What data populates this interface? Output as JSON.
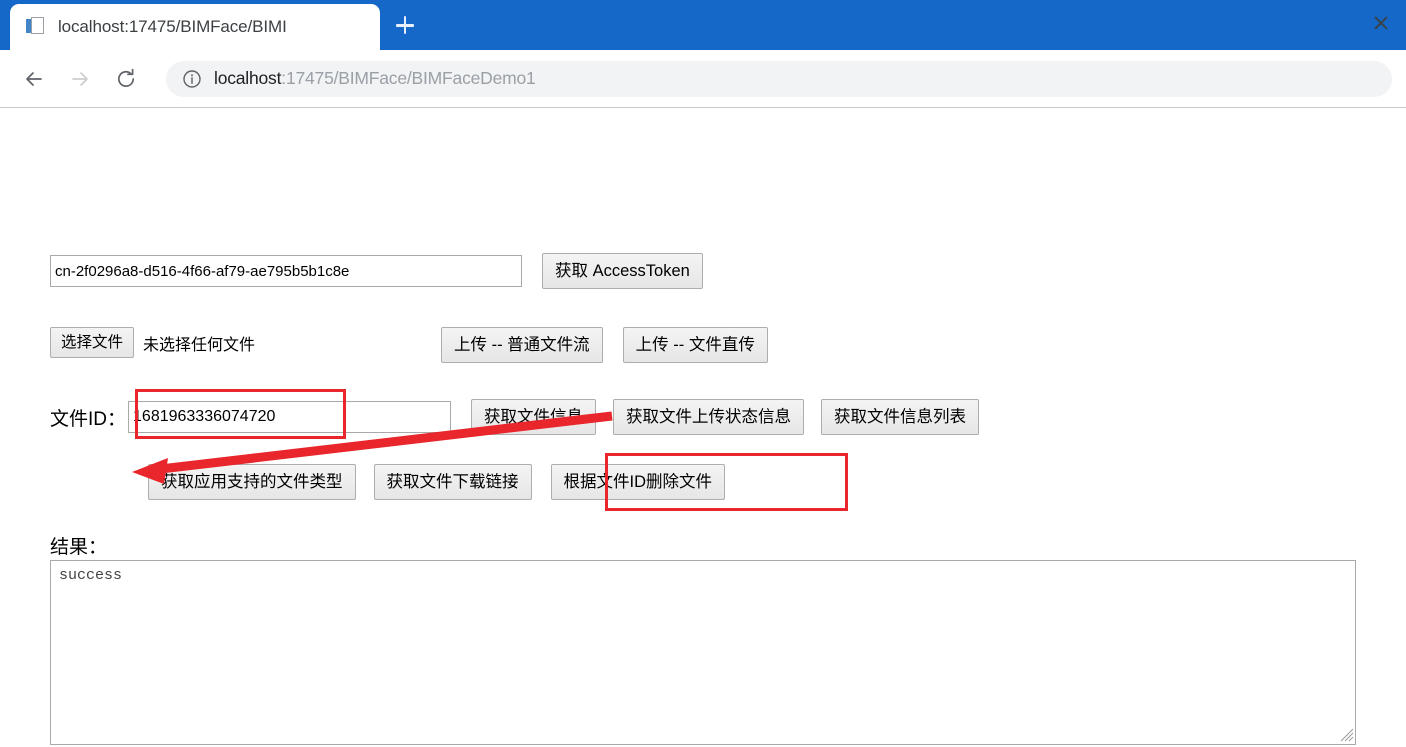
{
  "browser": {
    "tab": {
      "title": "localhost:17475/BIMFace/BIMI",
      "favicon": "page-document-icon",
      "close_label": "✕"
    },
    "new_tab_label": "+",
    "nav": {
      "back": "back-arrow-icon",
      "forward": "forward-arrow-icon",
      "reload": "reload-icon"
    },
    "omnibox": {
      "info_icon": "info-circle-icon",
      "host": "localhost",
      "path": ":17475/BIMFace/BIMFaceDemo1",
      "full_url": "localhost:17475/BIMFace/BIMFaceDemo1"
    },
    "accent_color": "#1568c8"
  },
  "page": {
    "token_row": {
      "input_value": "cn-2f0296a8-d516-4f66-af79-ae795b5b1c8e",
      "input_placeholder": "",
      "button_label": "获取 AccessToken"
    },
    "file_row": {
      "choose_label": "选择文件",
      "file_status": "未选择任何文件",
      "upload_stream_label": "上传 -- 普通文件流",
      "upload_direct_label": "上传 -- 文件直传"
    },
    "fileid_row": {
      "label": "文件ID：",
      "input_value": "1681963336074720",
      "input_placeholder": "",
      "btn_file_info": "获取文件信息",
      "btn_upload_status": "获取文件上传状态信息",
      "btn_file_info_list": "获取文件信息列表"
    },
    "action_row": {
      "btn_supported_types": "获取应用支持的文件类型",
      "btn_download_link": "获取文件下载链接",
      "btn_delete_by_id": "根据文件ID删除文件"
    },
    "result": {
      "label": "结果：",
      "value": "success",
      "placeholder": ""
    }
  },
  "annotations": {
    "color": "#e8262b",
    "box_fileid": "highlight-fileid-input",
    "box_delete_button": "highlight-delete-button",
    "arrow": "arrow-from-delete-button-to-result"
  }
}
